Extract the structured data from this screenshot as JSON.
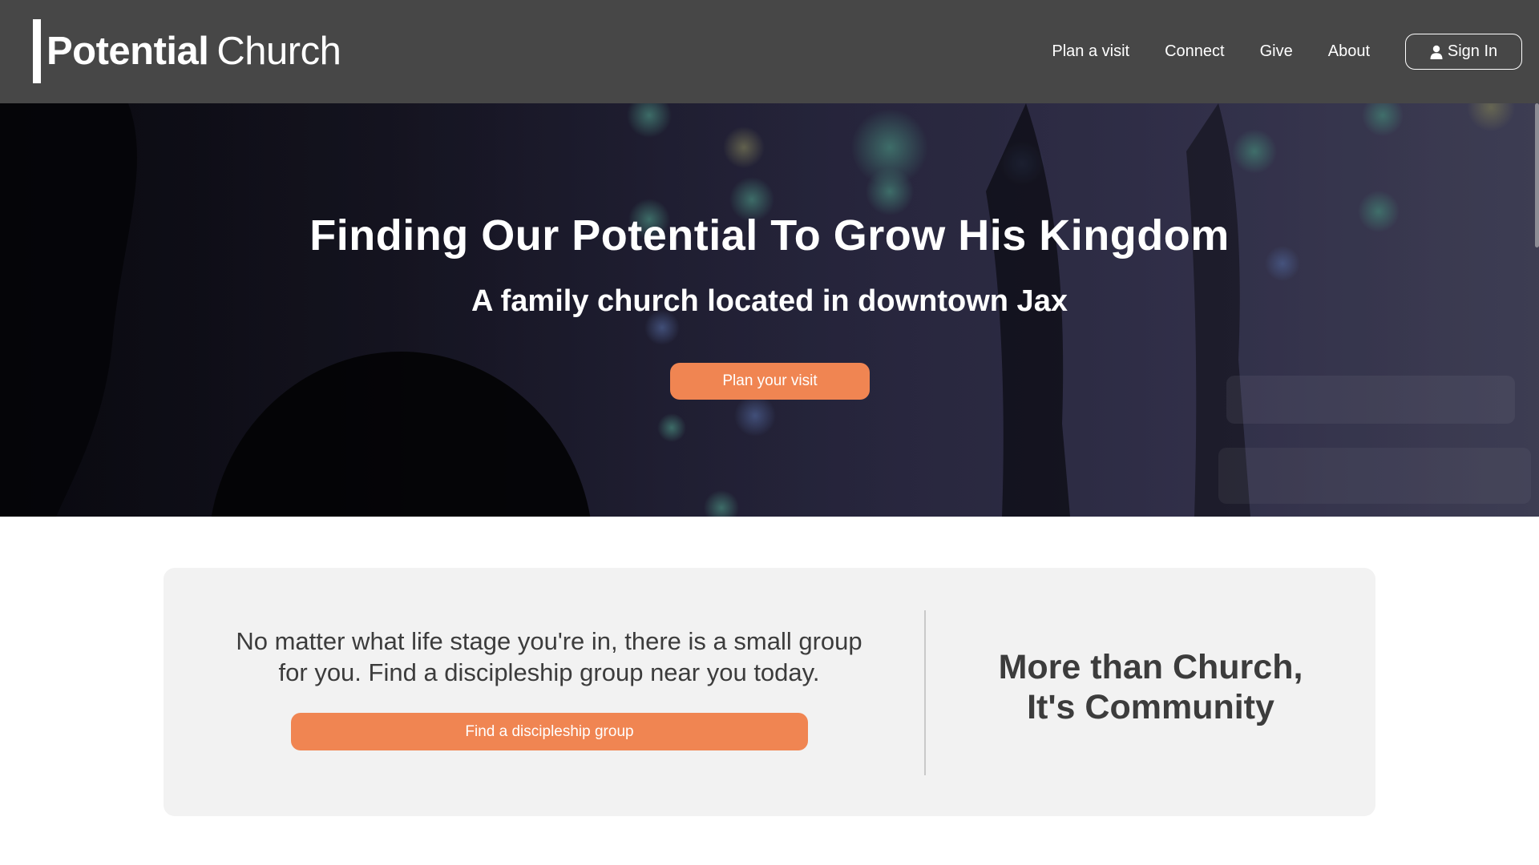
{
  "brand": {
    "name_bold": "Potential",
    "name_light": "Church"
  },
  "nav": {
    "links": [
      "Plan a visit",
      "Connect",
      "Give",
      "About"
    ],
    "signin_label": "Sign In",
    "signin_icon": "user-icon"
  },
  "hero": {
    "title": "Finding Our Potential To Grow His Kingdom",
    "subtitle": "A family church located in downtown Jax",
    "cta_label": "Plan your visit"
  },
  "card": {
    "paragraph_lines": [
      "No matter what life stage you're in, there is a small group",
      "for you. Find a discipleship group near you today."
    ],
    "button_label": "Find a discipleship group",
    "tagline_lines": [
      "More than Church,",
      "It's Community"
    ]
  },
  "colors": {
    "header_bg": "#474747",
    "accent": "#f08552",
    "card_bg": "#f2f2f2",
    "text_dark": "#3c3c3c"
  }
}
